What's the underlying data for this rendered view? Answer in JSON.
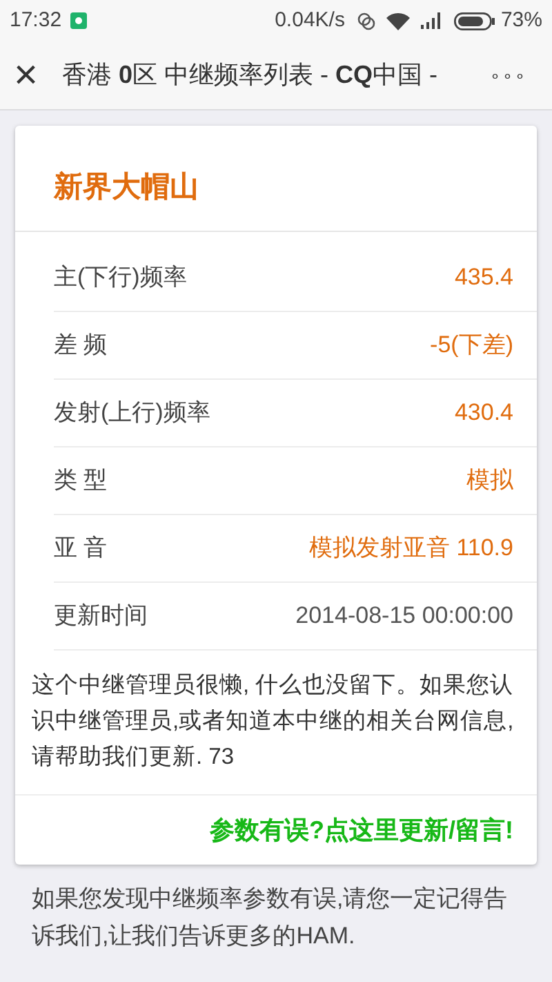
{
  "status_bar": {
    "time": "17:32",
    "speed": "0.04K/s",
    "battery": "73%"
  },
  "header": {
    "title": "香港 **0**区 中继频率列表 - **CQ**中国 -",
    "close": "×",
    "more": "∘∘∘"
  },
  "card": {
    "title": "新界大帽山",
    "rows": [
      {
        "label": "主(下行)频率",
        "value": "435.4",
        "accent": true
      },
      {
        "label": "差 频",
        "value": "-5(下差)",
        "accent": true
      },
      {
        "label": "发射(上行)频率",
        "value": "430.4",
        "accent": true
      },
      {
        "label": "类 型",
        "value": "模拟",
        "accent": true
      },
      {
        "label": "亚 音",
        "value": "模拟发射亚音 110.9",
        "accent": true
      },
      {
        "label": "更新时间",
        "value": "2014-08-15 00:00:00",
        "accent": false
      }
    ],
    "note": "这个中继管理员很懒, 什么也没留下。如果您认识中继管理员,或者知道本中继的相关台网信息,请帮助我们更新. 73",
    "link": "参数有误?点这里更新/留言!"
  },
  "footer": "如果您发现中继频率参数有误,请您一定记得告诉我们,让我们告诉更多的HAM."
}
